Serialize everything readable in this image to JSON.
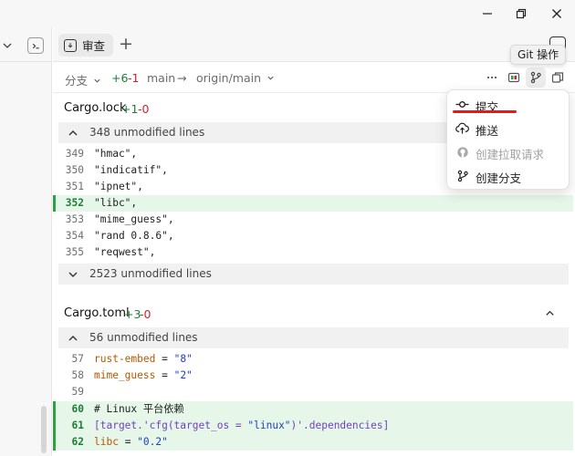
{
  "window": {
    "minimize_icon": "minimize-icon",
    "maximize_icon": "restore-icon",
    "close_icon": "close-icon"
  },
  "tabbar": {
    "tab_label": "审查",
    "new_tab_icon": "plus-icon"
  },
  "tooltip": {
    "text": "Git 操作"
  },
  "branchbar": {
    "changes_label": "分支",
    "added": "+6",
    "removed": "-1",
    "local_branch": "main",
    "arrow": "→",
    "remote_branch": "origin/main"
  },
  "files": [
    {
      "name": "Cargo.lock",
      "added": "+1",
      "removed": "-0",
      "unmodified_top": "348 unmodified lines",
      "unmodified_bottom": "2523 unmodified lines",
      "lines": [
        {
          "n": "349",
          "text": "\"hmac\","
        },
        {
          "n": "350",
          "text": "\"indicatif\","
        },
        {
          "n": "351",
          "text": "\"ipnet\","
        },
        {
          "n": "352",
          "text": "\"libc\",",
          "added": true
        },
        {
          "n": "353",
          "text": "\"mime_guess\","
        },
        {
          "n": "354",
          "text": "\"rand 0.8.6\","
        },
        {
          "n": "355",
          "text": "\"reqwest\","
        }
      ]
    },
    {
      "name": "Cargo.toml",
      "added": "+3",
      "removed": "-0",
      "unmodified_top": "56 unmodified lines",
      "lines": [
        {
          "n": "57",
          "key": "rust-embed",
          "eq": " = ",
          "val": "\"8\""
        },
        {
          "n": "58",
          "key": "mime_guess",
          "eq": " = ",
          "val": "\"2\""
        },
        {
          "n": "59",
          "text": ""
        },
        {
          "n": "60",
          "comment": "# Linux 平台依赖",
          "added": true
        },
        {
          "n": "61",
          "table_open": "[target.'cfg(target_os = ",
          "table_str": "\"linux\"",
          "table_close": ")'.dependencies]",
          "added": true
        },
        {
          "n": "62",
          "key": "libc",
          "eq": " = ",
          "val": "\"0.2\"",
          "added": true
        }
      ]
    }
  ],
  "git_menu": {
    "items": [
      {
        "label": "提交",
        "icon": "commit-icon",
        "enabled": true
      },
      {
        "label": "推送",
        "icon": "cloud-upload-icon",
        "enabled": true
      },
      {
        "label": "创建拉取请求",
        "icon": "github-icon",
        "enabled": false
      },
      {
        "label": "创建分支",
        "icon": "branch-icon",
        "enabled": true
      }
    ]
  },
  "colors": {
    "added_bg": "#e6f6e9",
    "added_bar": "#2ea043",
    "added_text": "#1a7f37",
    "removed_text": "#cf222e",
    "annotation_red": "#e01b1b"
  }
}
